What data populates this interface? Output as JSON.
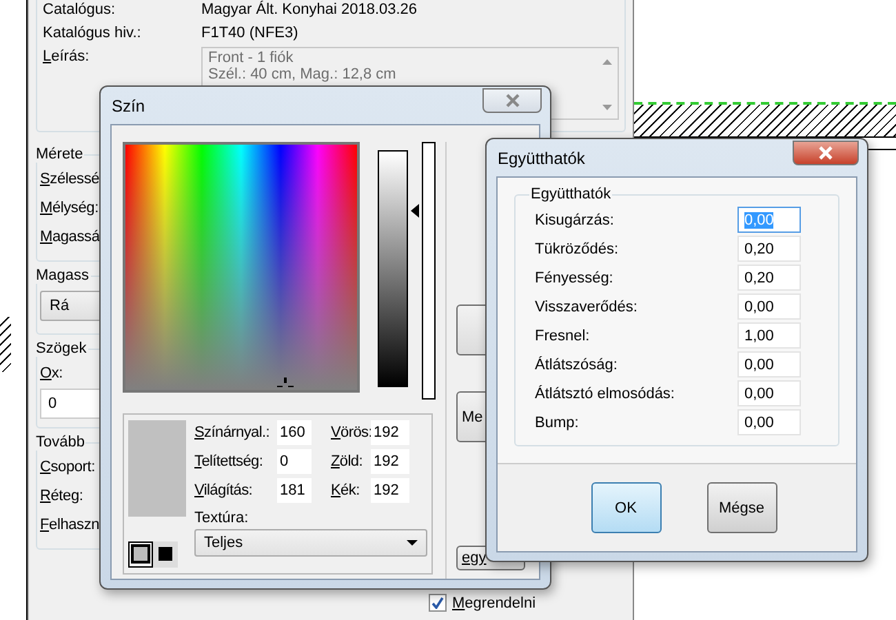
{
  "panel": {
    "info_rows": [
      {
        "label": "Catalógus:",
        "value": "Magyar Ált. Konyhai 2018.03.26"
      },
      {
        "label": "Katalógus hiv.:",
        "value": "F1T40 (NFE3)"
      }
    ],
    "description": {
      "label": "Leírás:",
      "lines": [
        "Front - 1 fiók",
        "Szél.: 40 cm, Mag.: 12,8 cm"
      ]
    },
    "groups": [
      {
        "title": "Mérete",
        "items": [
          {
            "kind": "label",
            "text": "Szélessé"
          },
          {
            "kind": "label",
            "text": "Mélység:"
          },
          {
            "kind": "label",
            "text": "Magassá"
          }
        ]
      },
      {
        "title": "Magass",
        "items": [
          {
            "kind": "dropdown",
            "text": "Rá"
          }
        ]
      },
      {
        "title": "Szögek",
        "items": [
          {
            "kind": "label",
            "text": "Ox:"
          },
          {
            "kind": "field",
            "text": "0"
          }
        ]
      },
      {
        "title": "Tovább",
        "items": [
          {
            "kind": "label",
            "text": "Csoport:"
          },
          {
            "kind": "label",
            "text": "Réteg:"
          },
          {
            "kind": "label",
            "text": "Felhaszn"
          }
        ]
      }
    ],
    "order_checkbox": {
      "label": "Megrendelni",
      "checked": true
    }
  },
  "color_dialog": {
    "title": "Szín",
    "luminance_slider": {
      "level": 0.75
    },
    "hsl": [
      {
        "label": "Színárnyal.:",
        "value": "160"
      },
      {
        "label": "Telítettség:",
        "value": "0"
      },
      {
        "label": "Világítás:",
        "value": "181"
      }
    ],
    "rgb": [
      {
        "label": "Vörös:",
        "value": "192"
      },
      {
        "label": "Zöld:",
        "value": "192"
      },
      {
        "label": "Kék:",
        "value": "192"
      }
    ],
    "texture": {
      "label": "Textúra:",
      "value": "Teljes"
    },
    "side_buttons": [
      "Me",
      "egy"
    ]
  },
  "coefficients_dialog": {
    "title": "Együtthatók",
    "group_title": "Együtthatók",
    "rows": [
      {
        "label": "Kisugárzás:",
        "value": "0,00",
        "selected": true
      },
      {
        "label": "Tükröződés:",
        "value": "0,20",
        "selected": false
      },
      {
        "label": "Fényesség:",
        "value": "0,20",
        "selected": false
      },
      {
        "label": "Visszaverődés:",
        "value": "0,00",
        "selected": false
      },
      {
        "label": "Fresnel:",
        "value": "1,00",
        "selected": false
      },
      {
        "label": "Átlátszóság:",
        "value": "0,00",
        "selected": false
      },
      {
        "label": "Átlátsztó elmosódás:",
        "value": "0,00",
        "selected": false
      },
      {
        "label": "Bump:",
        "value": "0,00",
        "selected": false
      }
    ],
    "buttons": [
      {
        "label": "OK",
        "default": true
      },
      {
        "label": "Mégse",
        "default": false
      }
    ]
  }
}
